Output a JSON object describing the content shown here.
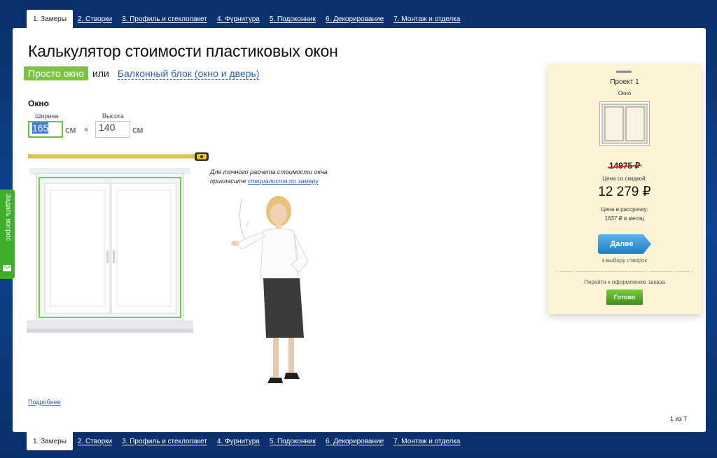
{
  "tabs": [
    {
      "label": "1. Замеры",
      "active": true
    },
    {
      "label": "2. Створки",
      "active": false
    },
    {
      "label": "3. Профиль и стеклопакет",
      "active": false
    },
    {
      "label": "4. Фурнитура",
      "active": false
    },
    {
      "label": "5. Подоконник",
      "active": false
    },
    {
      "label": "6. Декорирование",
      "active": false
    },
    {
      "label": "7. Монтаж и отделка",
      "active": false
    }
  ],
  "title": "Калькулятор стоимости пластиковых окон",
  "mode": {
    "active_label": "Просто окно",
    "or_label": "или",
    "alt_label": "Балконный блок (окно и дверь)"
  },
  "window_section": {
    "label": "Окно",
    "width_label": "Ширина",
    "width_value": "165",
    "height_label": "Высота",
    "height_value": "140",
    "unit": "см",
    "times": "×"
  },
  "hint": {
    "text_before": "Для точного расчета стоимости окна пригласите ",
    "link": "специалиста по замеру"
  },
  "more_link": "Подробнее",
  "pager": "1 из 7",
  "card": {
    "project": "Проект 1",
    "type": "Окно",
    "old_price": "14975 ₽",
    "discount_label": "Цена со скидкой:",
    "new_price": "12 279 ₽",
    "installment_label": "Цена в рассрочку:",
    "installment_value": "1637 ₽ в месяц",
    "next_button": "Далее",
    "next_sub": "к выбору створок",
    "order_label": "Перейти к оформлению заказа",
    "done_button": "Готово"
  },
  "ask_question": "Задать вопрос",
  "colors": {
    "background": "#0d4590",
    "accent_green": "#7cc243",
    "link_blue": "#2a62b5",
    "card_bg": "#fdf4d7"
  }
}
